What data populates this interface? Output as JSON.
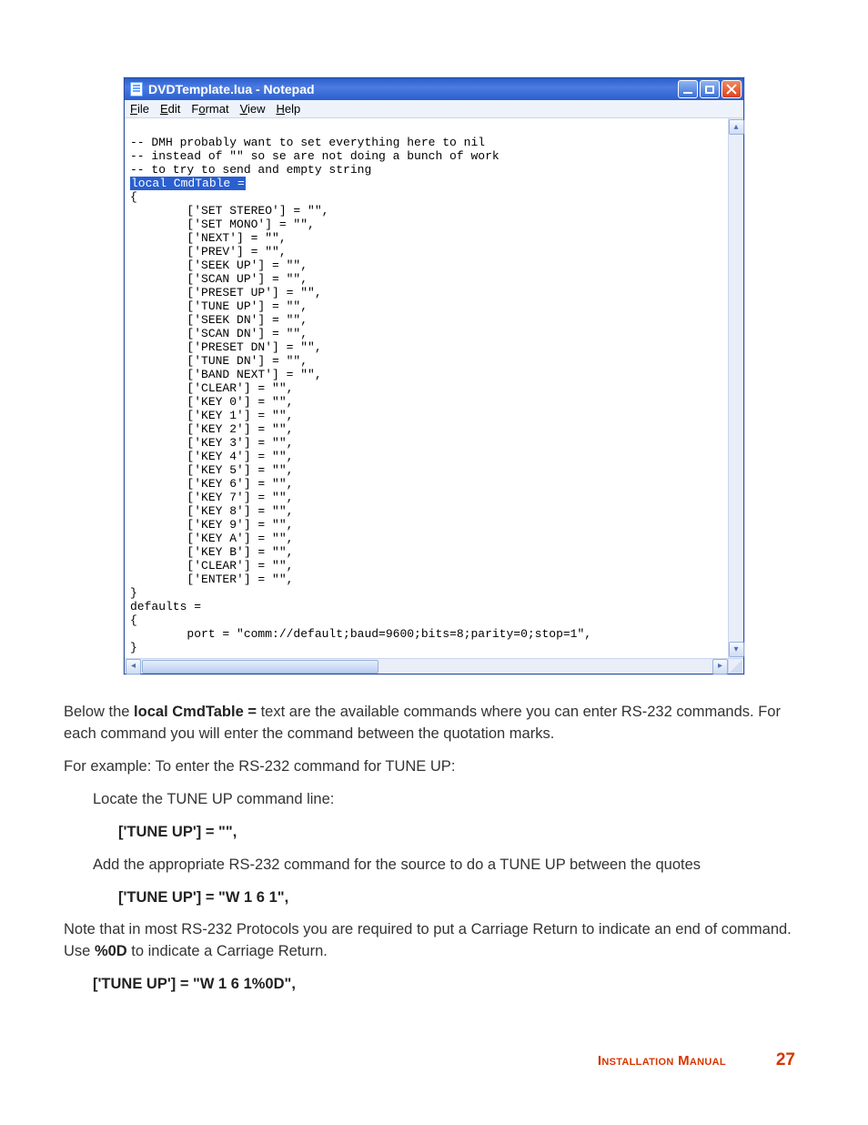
{
  "window": {
    "title": "DVDTemplate.lua - Notepad",
    "menus": [
      "File",
      "Edit",
      "Format",
      "View",
      "Help"
    ]
  },
  "editor": {
    "pre_comment": "-- DMH probably want to set everything here to nil\n-- instead of \"\" so se are not doing a bunch of work\n-- to try to send and empty string",
    "highlight": "local CmdTable =",
    "open_brace": "{",
    "entries": [
      "['SET STEREO'] = \"\",",
      "['SET MONO'] = \"\",",
      "['NEXT'] = \"\",",
      "['PREV'] = \"\",",
      "['SEEK UP'] = \"\",",
      "['SCAN UP'] = \"\",",
      "['PRESET UP'] = \"\",",
      "['TUNE UP'] = \"\",",
      "['SEEK DN'] = \"\",",
      "['SCAN DN'] = \"\",",
      "['PRESET DN'] = \"\",",
      "['TUNE DN'] = \"\",",
      "['BAND NEXT'] = \"\",",
      "['CLEAR'] = \"\",",
      "['KEY 0'] = \"\",",
      "['KEY 1'] = \"\",",
      "['KEY 2'] = \"\",",
      "['KEY 3'] = \"\",",
      "['KEY 4'] = \"\",",
      "['KEY 5'] = \"\",",
      "['KEY 6'] = \"\",",
      "['KEY 7'] = \"\",",
      "['KEY 8'] = \"\",",
      "['KEY 9'] = \"\",",
      "['KEY A'] = \"\",",
      "['KEY B'] = \"\",",
      "['CLEAR'] = \"\",",
      "['ENTER'] = \"\","
    ],
    "close_brace": "}",
    "defaults_header": "defaults =",
    "defaults_open": "{",
    "defaults_line": "port = \"comm://default;baud=9600;bits=8;parity=0;stop=1\",",
    "defaults_close": "}"
  },
  "copy": {
    "p1_a": "Below the   ",
    "p1_bold": "local CmdTable =",
    "p1_b": "     text are the available commands where you can enter RS-232 commands.  For each command you will enter the command between the quotation marks.",
    "p2": "For example:  To enter the RS-232 command for TUNE UP:",
    "p3": "Locate the TUNE UP command line:",
    "code1": "['TUNE UP'] = \"\",",
    "p4": "Add the appropriate RS-232 command for the source to do a TUNE UP between the quotes",
    "code2": "['TUNE UP'] = \"W 1 6 1\",",
    "p5_a": "Note that in most RS-232 Protocols you are required to put a Carriage Return to indicate an end of command.  Use ",
    "p5_bold": "%0D",
    "p5_b": " to indicate a Carriage Return.",
    "code3": "['TUNE UP'] = \"W 1 6 1%0D\","
  },
  "footer": {
    "title": "Installation Manual",
    "page": "27"
  }
}
